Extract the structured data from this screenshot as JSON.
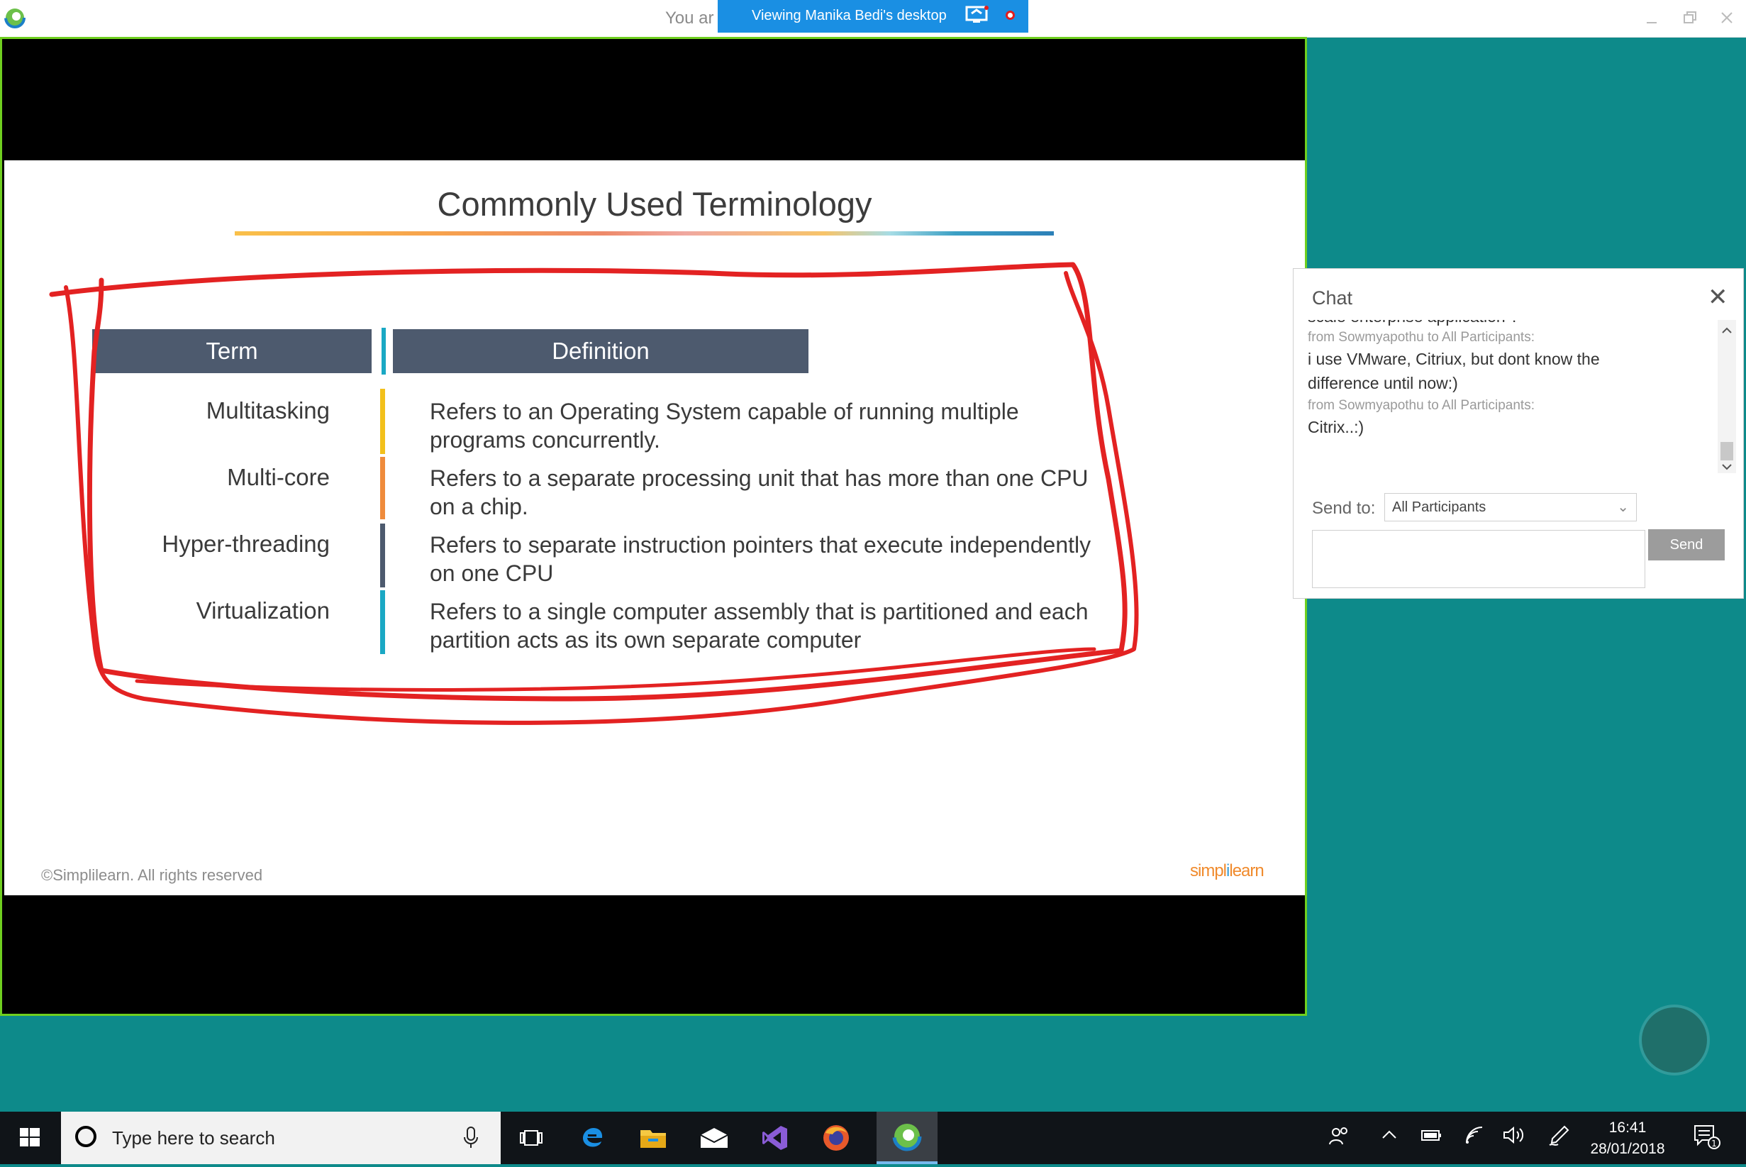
{
  "window": {
    "title_partial": "You ar",
    "banner_text": "Viewing Manika Bedi's desktop"
  },
  "slide": {
    "title": "Commonly Used Terminology",
    "headers": {
      "term": "Term",
      "definition": "Definition"
    },
    "rows": [
      {
        "term": "Multitasking",
        "definition_line1": "Refers to an Operating System capable of running multiple",
        "definition_line2": "programs concurrently.",
        "accent": "#f2c01b"
      },
      {
        "term": "Multi-core",
        "definition_line1": "Refers to a separate processing unit that has more than one CPU",
        "definition_line2": "on a chip.",
        "accent": "#ef8b3c"
      },
      {
        "term": "Hyper-threading",
        "definition_line1": "Refers to separate instruction pointers that execute independently",
        "definition_line2": "on one CPU",
        "accent": "#4d5a6e"
      },
      {
        "term": "Virtualization",
        "definition_line1": "Refers to a single computer assembly that is partitioned and each",
        "definition_line2": "partition acts as its own separate computer",
        "accent": "#1aa8c4"
      }
    ],
    "copyright": "©Simplilearn. All rights reserved",
    "brand": "simplilearn",
    "header_divider_color": "#1aa8c4",
    "header_color": "#4d5a6e"
  },
  "chat": {
    "title": "Chat",
    "messages": [
      {
        "kind": "text",
        "text": "scale enterprise application ?"
      },
      {
        "kind": "meta",
        "text": "from Sowmyapothu to All Participants:"
      },
      {
        "kind": "text",
        "text": "i use VMware, Citriux, but dont know the"
      },
      {
        "kind": "text",
        "text": "difference until now:)"
      },
      {
        "kind": "meta",
        "text": "from Sowmyapothu to All Participants:"
      },
      {
        "kind": "text",
        "text": "Citrix..:)"
      }
    ],
    "send_to_label": "Send to:",
    "send_to_value": "All Participants",
    "send_button": "Send",
    "input_value": ""
  },
  "taskbar": {
    "search_placeholder": "Type here to search",
    "time": "16:41",
    "date": "28/01/2018",
    "notification_count": "1",
    "apps": [
      "task-view-icon",
      "edge-icon",
      "file-explorer-icon",
      "mail-icon",
      "visual-studio-icon",
      "firefox-icon",
      "webex-icon"
    ]
  },
  "colors": {
    "desktop": "#0d8a8a",
    "banner": "#1a8fe3",
    "screen_border": "#6fcf1f",
    "annotation": "#e32222"
  }
}
